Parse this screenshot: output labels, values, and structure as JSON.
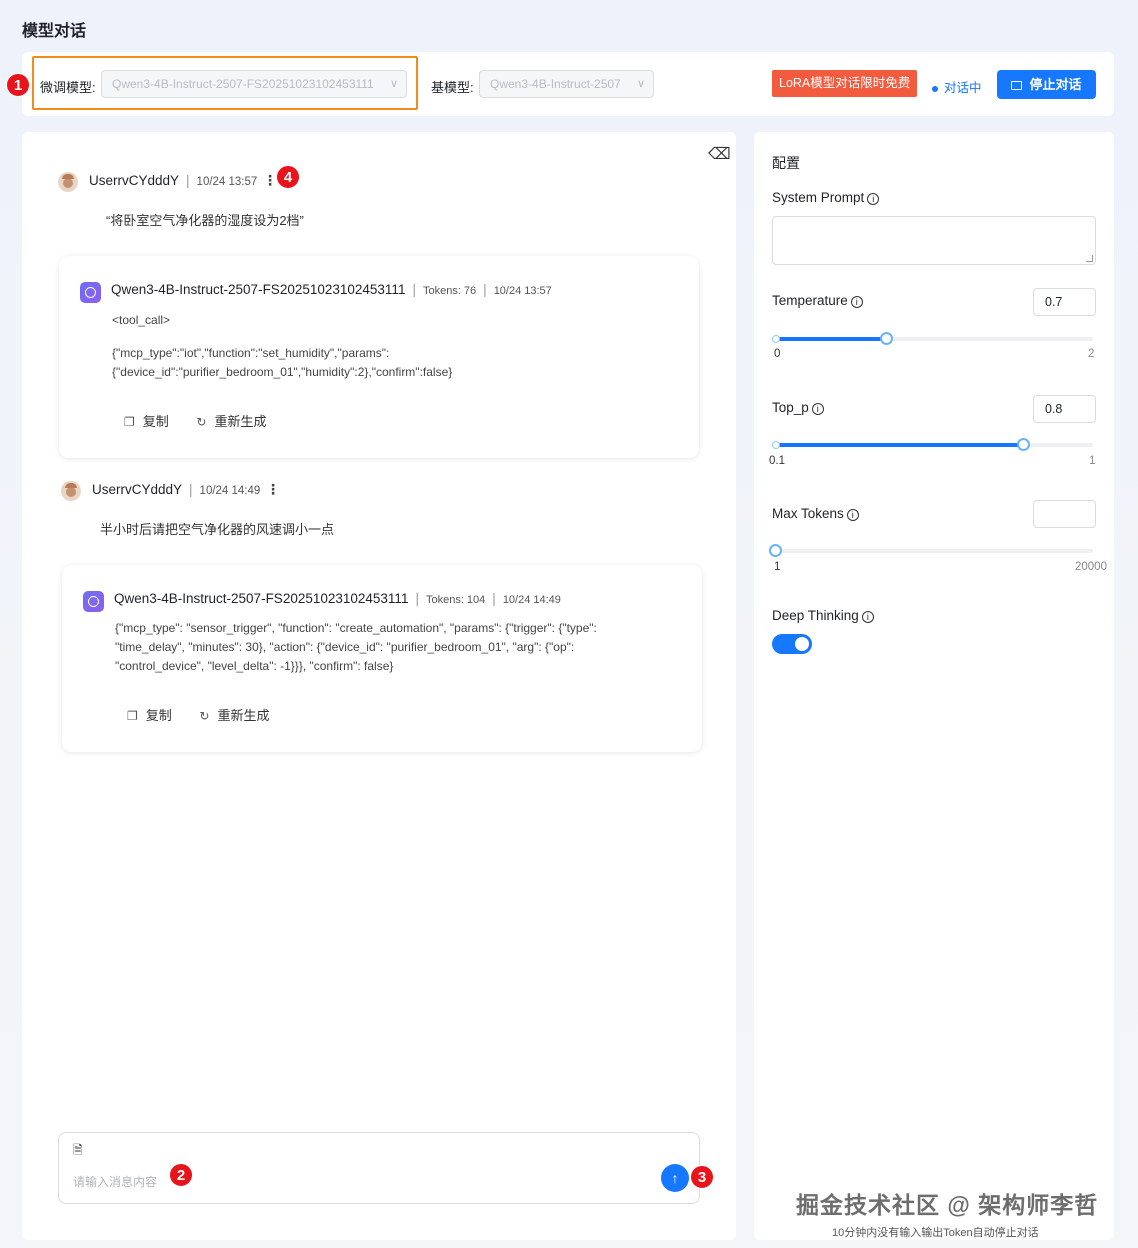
{
  "page_title": "模型对话",
  "topbar": {
    "finetuned_label": "微调模型:",
    "finetuned_value": "Qwen3-4B-Instruct-2507-FS20251023102453111",
    "base_label": "基模型:",
    "base_value": "Qwen3-4B-Instruct-2507",
    "free_badge": "LoRA模型对话限时免费",
    "status": "对话中",
    "stop_button": "停止对话"
  },
  "markers": [
    "1",
    "2",
    "3",
    "4"
  ],
  "messages": [
    {
      "user": "UserrvCYdddY",
      "time": "10/24 13:57",
      "text": "“将卧室空气净化器的湿度设为2档”",
      "bot": {
        "name": "Qwen3-4B-Instruct-2507-FS20251023102453111",
        "tokens": "Tokens: 76",
        "time": "10/24 13:57",
        "line0": "<tool_call>",
        "line1": "{\"mcp_type\":\"iot\",\"function\":\"set_humidity\",\"params\":",
        "line2": "{\"device_id\":\"purifier_bedroom_01\",\"humidity\":2},\"confirm\":false}"
      }
    },
    {
      "user": "UserrvCYdddY",
      "time": "10/24 14:49",
      "text": "半小时后请把空气净化器的风速调小一点",
      "bot": {
        "name": "Qwen3-4B-Instruct-2507-FS20251023102453111",
        "tokens": "Tokens: 104",
        "time": "10/24 14:49",
        "line1": "{\"mcp_type\": \"sensor_trigger\", \"function\": \"create_automation\", \"params\": {\"trigger\": {\"type\":",
        "line2": "\"time_delay\", \"minutes\": 30}, \"action\": {\"device_id\": \"purifier_bedroom_01\", \"arg\": {\"op\":",
        "line3": "\"control_device\", \"level_delta\": -1}}}, \"confirm\": false}"
      }
    }
  ],
  "actions": {
    "copy": "复制",
    "regenerate": "重新生成"
  },
  "input": {
    "placeholder": "请输入消息内容"
  },
  "config": {
    "title": "配置",
    "system_prompt_label": "System Prompt",
    "temperature": {
      "label": "Temperature",
      "value": "0.7",
      "min": "0",
      "max": "2",
      "fraction": 0.35
    },
    "top_p": {
      "label": "Top_p",
      "value": "0.8",
      "min": "0.1",
      "max": "1",
      "fraction": 0.78
    },
    "max_tokens": {
      "label": "Max Tokens",
      "value": "",
      "min": "1",
      "max": "20000",
      "fraction": 0.0
    },
    "deep_thinking": {
      "label": "Deep Thinking",
      "enabled": true
    }
  },
  "watermark": "掘金技术社区 @ 架构师李哲",
  "footnote": "10分钟内没有输入输出Token自动停止对话",
  "icons": {
    "info": "i",
    "copy": "❐",
    "regen": "↻",
    "send": "↑",
    "attach": "🗎",
    "clear": "⌫",
    "chevron": "∨"
  }
}
